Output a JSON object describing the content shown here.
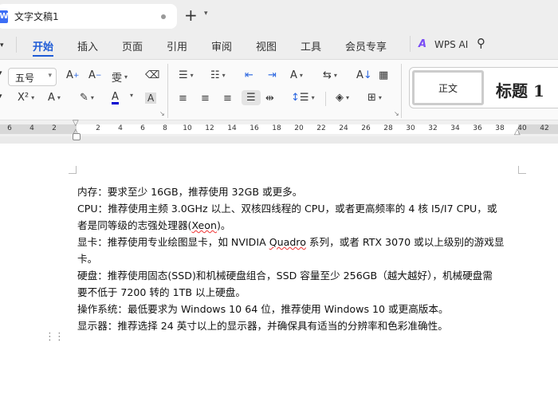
{
  "tabbar": {
    "doc_title": "文字文稿1",
    "logo": "W",
    "new_tab": "+",
    "chevron": "⌄"
  },
  "menu": {
    "items": [
      "开始",
      "插入",
      "页面",
      "引用",
      "审阅",
      "视图",
      "工具",
      "会员专享"
    ],
    "active": 0,
    "ai_label": "WPS AI"
  },
  "toolbar": {
    "font_size": "五号",
    "styles": {
      "normal": "正文",
      "heading1": "标题 1"
    }
  },
  "ruler": {
    "left_ticks": [
      "6",
      "4",
      "2"
    ],
    "right_ticks": [
      "2",
      "4",
      "6",
      "8",
      "10",
      "12",
      "14",
      "16",
      "18",
      "20",
      "22",
      "24",
      "26",
      "28",
      "30",
      "32",
      "34",
      "36",
      "38",
      "40",
      "42"
    ]
  },
  "document": {
    "paragraphs": [
      {
        "lines": [
          "内存：要求至少 16GB，推荐使用 32GB 或更多。"
        ]
      },
      {
        "lines": [
          "CPU：推荐使用主频 3.0GHz 以上、双核四线程的 CPU，或者更高频率的 4 核 I5/I7 CPU，或",
          "者是同等级的志强处理器(Xeon)。"
        ]
      },
      {
        "lines": [
          "显卡：推荐使用专业绘图显卡，如 NVIDIA Quadro 系列，或者 RTX 3070 或以上级别的游戏显",
          "卡。"
        ]
      },
      {
        "lines": [
          "硬盘：推荐使用固态(SSD)和机械硬盘组合，SSD 容量至少 256GB（越大越好），机械硬盘需",
          "要不低于 7200 转的 1TB 以上硬盘。"
        ]
      },
      {
        "lines": [
          "操作系统：最低要求为 Windows 10 64 位，推荐使用 Windows 10 或更高版本。"
        ]
      },
      {
        "lines": [
          "显示器：推荐选择 24 英寸以上的显示器，并确保具有适当的分辨率和色彩准确性。"
        ]
      }
    ]
  }
}
